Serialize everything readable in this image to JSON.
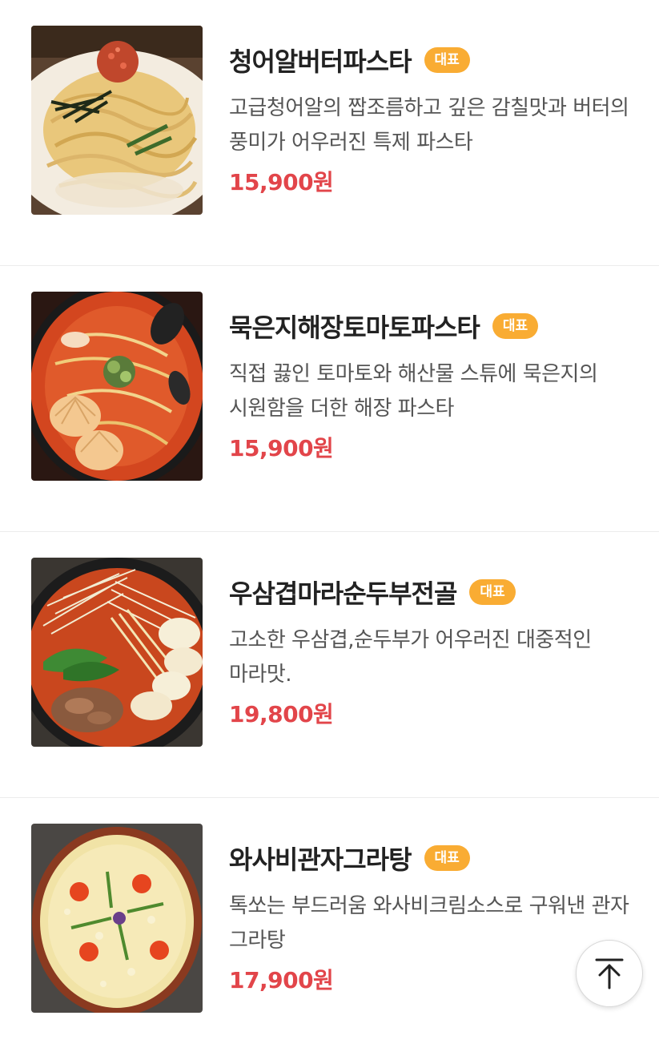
{
  "menu": {
    "items": [
      {
        "title": "청어알버터파스타",
        "badge": "대표",
        "description": "고급청어알의 짭조름하고 깊은 감칠맛과 버터의 풍미가 어우러진 특제 파스타",
        "price": "15,900원",
        "image": "pasta-roe-butter-photo"
      },
      {
        "title": "묵은지해장토마토파스타",
        "badge": "대표",
        "description": "직접 끓인 토마토와 해산물 스튜에 묵은지의 시원함을 더한 해장 파스타",
        "price": "15,900원",
        "image": "pasta-tomato-seafood-photo"
      },
      {
        "title": "우삼겹마라순두부전골",
        "badge": "대표",
        "description": "고소한 우삼겹,순두부가 어우러진 대중적인 마라맛.",
        "price": "19,800원",
        "image": "mala-sundubu-hotpot-photo"
      },
      {
        "title": "와사비관자그라탕",
        "badge": "대표",
        "description": "톡쏘는 부드러움 와사비크림소스로 구워낸 관자 그라탕",
        "price": "17,900원",
        "image": "wasabi-scallop-gratin-photo"
      }
    ]
  },
  "scroll_top": {
    "icon": "arrow-up-icon"
  },
  "colors": {
    "badge": "#f9ac33",
    "price": "#e2454a",
    "title": "#222222",
    "description": "#555555"
  }
}
